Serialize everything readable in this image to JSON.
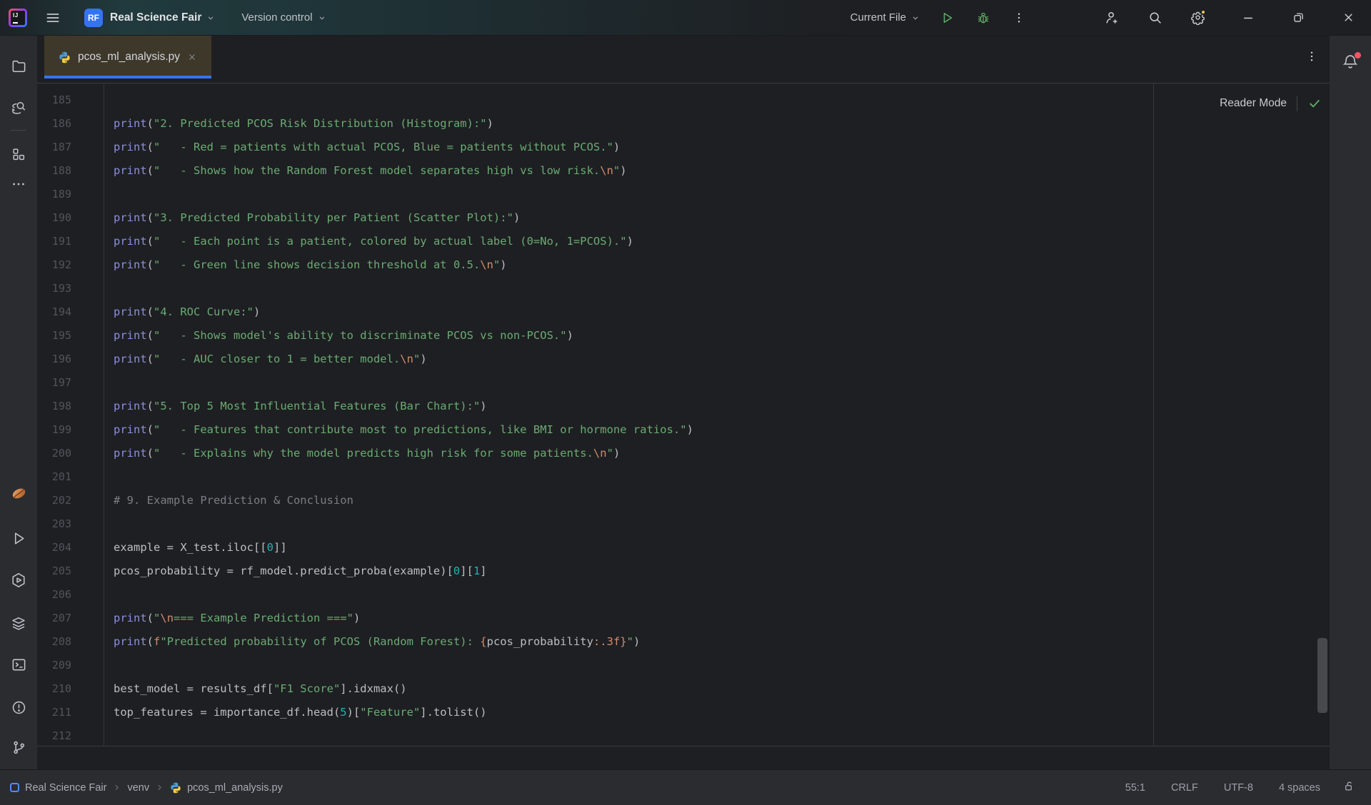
{
  "title_bar": {
    "project": {
      "avatar": "RF",
      "name": "Real Science Fair"
    },
    "vcs_label": "Version control",
    "run_config_label": "Current File"
  },
  "tab_bar": {
    "tabs": [
      {
        "name": "pcos_ml_analysis.py",
        "active": true
      }
    ]
  },
  "editor": {
    "reader_mode_label": "Reader Mode",
    "lines": [
      {
        "n": "185",
        "spans": []
      },
      {
        "n": "186",
        "spans": [
          {
            "c": "k",
            "t": "print"
          },
          {
            "c": "d",
            "t": "("
          },
          {
            "c": "s",
            "t": "\"2. Predicted PCOS Risk Distribution (Histogram):\""
          },
          {
            "c": "d",
            "t": ")"
          }
        ]
      },
      {
        "n": "187",
        "spans": [
          {
            "c": "k",
            "t": "print"
          },
          {
            "c": "d",
            "t": "("
          },
          {
            "c": "s",
            "t": "\"   - Red = patients with actual PCOS, Blue = patients without PCOS.\""
          },
          {
            "c": "d",
            "t": ")"
          }
        ]
      },
      {
        "n": "188",
        "spans": [
          {
            "c": "k",
            "t": "print"
          },
          {
            "c": "d",
            "t": "("
          },
          {
            "c": "s",
            "t": "\"   - Shows how the Random Forest model separates high vs low risk."
          },
          {
            "c": "e",
            "t": "\\n"
          },
          {
            "c": "s",
            "t": "\""
          },
          {
            "c": "d",
            "t": ")"
          }
        ]
      },
      {
        "n": "189",
        "spans": []
      },
      {
        "n": "190",
        "spans": [
          {
            "c": "k",
            "t": "print"
          },
          {
            "c": "d",
            "t": "("
          },
          {
            "c": "s",
            "t": "\"3. Predicted Probability per Patient (Scatter Plot):\""
          },
          {
            "c": "d",
            "t": ")"
          }
        ]
      },
      {
        "n": "191",
        "spans": [
          {
            "c": "k",
            "t": "print"
          },
          {
            "c": "d",
            "t": "("
          },
          {
            "c": "s",
            "t": "\"   - Each point is a patient, colored by actual label (0=No, 1=PCOS).\""
          },
          {
            "c": "d",
            "t": ")"
          }
        ]
      },
      {
        "n": "192",
        "spans": [
          {
            "c": "k",
            "t": "print"
          },
          {
            "c": "d",
            "t": "("
          },
          {
            "c": "s",
            "t": "\"   - Green line shows decision threshold at 0.5."
          },
          {
            "c": "e",
            "t": "\\n"
          },
          {
            "c": "s",
            "t": "\""
          },
          {
            "c": "d",
            "t": ")"
          }
        ]
      },
      {
        "n": "193",
        "spans": []
      },
      {
        "n": "194",
        "spans": [
          {
            "c": "k",
            "t": "print"
          },
          {
            "c": "d",
            "t": "("
          },
          {
            "c": "s",
            "t": "\"4. ROC Curve:\""
          },
          {
            "c": "d",
            "t": ")"
          }
        ]
      },
      {
        "n": "195",
        "spans": [
          {
            "c": "k",
            "t": "print"
          },
          {
            "c": "d",
            "t": "("
          },
          {
            "c": "s",
            "t": "\"   - Shows model's ability to discriminate PCOS vs non-PCOS.\""
          },
          {
            "c": "d",
            "t": ")"
          }
        ]
      },
      {
        "n": "196",
        "spans": [
          {
            "c": "k",
            "t": "print"
          },
          {
            "c": "d",
            "t": "("
          },
          {
            "c": "s",
            "t": "\"   - AUC closer to 1 = better model."
          },
          {
            "c": "e",
            "t": "\\n"
          },
          {
            "c": "s",
            "t": "\""
          },
          {
            "c": "d",
            "t": ")"
          }
        ]
      },
      {
        "n": "197",
        "spans": []
      },
      {
        "n": "198",
        "spans": [
          {
            "c": "k",
            "t": "print"
          },
          {
            "c": "d",
            "t": "("
          },
          {
            "c": "s",
            "t": "\"5. Top 5 Most Influential Features (Bar Chart):\""
          },
          {
            "c": "d",
            "t": ")"
          }
        ]
      },
      {
        "n": "199",
        "spans": [
          {
            "c": "k",
            "t": "print"
          },
          {
            "c": "d",
            "t": "("
          },
          {
            "c": "s",
            "t": "\"   - Features that contribute most to predictions, like BMI or hormone ratios.\""
          },
          {
            "c": "d",
            "t": ")"
          }
        ]
      },
      {
        "n": "200",
        "spans": [
          {
            "c": "k",
            "t": "print"
          },
          {
            "c": "d",
            "t": "("
          },
          {
            "c": "s",
            "t": "\"   - Explains why the model predicts high risk for some patients."
          },
          {
            "c": "e",
            "t": "\\n"
          },
          {
            "c": "s",
            "t": "\""
          },
          {
            "c": "d",
            "t": ")"
          }
        ]
      },
      {
        "n": "201",
        "spans": []
      },
      {
        "n": "202",
        "spans": [
          {
            "c": "c",
            "t": "# 9. Example Prediction & Conclusion"
          }
        ]
      },
      {
        "n": "203",
        "spans": []
      },
      {
        "n": "204",
        "spans": [
          {
            "c": "d",
            "t": "example = X_test.iloc[["
          },
          {
            "c": "n",
            "t": "0"
          },
          {
            "c": "d",
            "t": "]]"
          }
        ]
      },
      {
        "n": "205",
        "spans": [
          {
            "c": "d",
            "t": "pcos_probability = rf_model.predict_proba(example)["
          },
          {
            "c": "n",
            "t": "0"
          },
          {
            "c": "d",
            "t": "]["
          },
          {
            "c": "n",
            "t": "1"
          },
          {
            "c": "d",
            "t": "]"
          }
        ]
      },
      {
        "n": "206",
        "spans": []
      },
      {
        "n": "207",
        "spans": [
          {
            "c": "k",
            "t": "print"
          },
          {
            "c": "d",
            "t": "("
          },
          {
            "c": "s",
            "t": "\""
          },
          {
            "c": "e",
            "t": "\\n"
          },
          {
            "c": "s",
            "t": "=== Example Prediction ===\""
          },
          {
            "c": "d",
            "t": ")"
          }
        ]
      },
      {
        "n": "208",
        "spans": [
          {
            "c": "k",
            "t": "print"
          },
          {
            "c": "d",
            "t": "("
          },
          {
            "c": "e",
            "t": "f"
          },
          {
            "c": "s",
            "t": "\"Predicted probability of PCOS (Random Forest): "
          },
          {
            "c": "e",
            "t": "{"
          },
          {
            "c": "d",
            "t": "pcos_probability"
          },
          {
            "c": "e",
            "t": ":.3f}"
          },
          {
            "c": "s",
            "t": "\""
          },
          {
            "c": "d",
            "t": ")"
          }
        ]
      },
      {
        "n": "209",
        "spans": []
      },
      {
        "n": "210",
        "spans": [
          {
            "c": "d",
            "t": "best_model = results_df["
          },
          {
            "c": "s",
            "t": "\"F1 Score\""
          },
          {
            "c": "d",
            "t": "].idxmax()"
          }
        ]
      },
      {
        "n": "211",
        "spans": [
          {
            "c": "d",
            "t": "top_features = importance_df.head("
          },
          {
            "c": "n",
            "t": "5"
          },
          {
            "c": "d",
            "t": ")["
          },
          {
            "c": "s",
            "t": "\"Feature\""
          },
          {
            "c": "d",
            "t": "].tolist()"
          }
        ]
      },
      {
        "n": "212",
        "spans": []
      }
    ]
  },
  "status_bar": {
    "breadcrumbs": [
      "Real Science Fair",
      "venv",
      "pcos_ml_analysis.py"
    ],
    "caret": "55:1",
    "line_separator": "CRLF",
    "encoding": "UTF-8",
    "indent": "4 spaces"
  },
  "colors": {
    "accent_blue": "#3574f0",
    "run_green": "#5fad65",
    "string_green": "#6aab73",
    "builtin_purple": "#8c8ee0",
    "number_teal": "#2aacb8",
    "escape_orange": "#cf8e6d",
    "comment_gray": "#7a7e85",
    "tab_highlight": "#3e382b",
    "notification_red": "#f75464",
    "settings_badge_yellow": "#f2c55c"
  }
}
